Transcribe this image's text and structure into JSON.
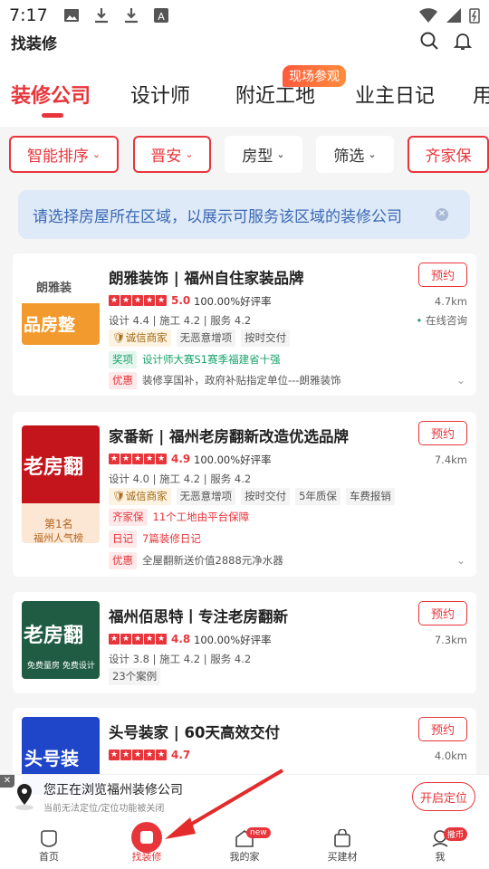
{
  "status": {
    "time": "7:17"
  },
  "appbar": {
    "title": "找装修"
  },
  "tabs": [
    {
      "label": "装修公司"
    },
    {
      "label": "设计师"
    },
    {
      "label": "附近工地",
      "badge": "现场参观"
    },
    {
      "label": "业主日记"
    },
    {
      "label": "用"
    }
  ],
  "filters": [
    {
      "label": "智能排序"
    },
    {
      "label": "晋安"
    },
    {
      "label": "房型"
    },
    {
      "label": "筛选"
    },
    {
      "label": "齐家保"
    }
  ],
  "notice": {
    "text": "请选择房屋所在区域，以展示可服务该区域的装修公司"
  },
  "companies": [
    {
      "name": "朗雅装饰 | 福州自住家装品牌",
      "logo_text": "品房整",
      "logo_brand": "朗雅装",
      "score": "5.0",
      "rating": "100.00%好评率",
      "distance": "4.7km",
      "scores": "设计 4.4 | 施工 4.2 | 服务 4.2",
      "online": "在线咨询",
      "tags": [
        "诚信商家",
        "无恶意增项",
        "按时交付"
      ],
      "award_tag": "奖项",
      "award_text": "设计师大赛S1赛季福建省十强",
      "promo_tag": "优惠",
      "promo_text": "装修享国补，政府补贴指定单位---朗雅装饰",
      "book": "预约"
    },
    {
      "name": "家番新 | 福州老房翻新改造优选品牌",
      "logo_text": "老房翻",
      "rank_label": "第1名",
      "rank_sub": "福州人气榜",
      "score": "4.9",
      "rating": "100.00%好评率",
      "distance": "7.4km",
      "scores": "设计 4.0 | 施工 4.2 | 服务 4.2",
      "tags": [
        "诚信商家",
        "无恶意增项",
        "按时交付",
        "5年质保",
        "车费报销"
      ],
      "guarantee_tag": "齐家保",
      "guarantee_text": "11个工地由平台保障",
      "diary_tag": "日记",
      "diary_text": "7篇装修日记",
      "promo_tag": "优惠",
      "promo_text": "全屋翻新送价值2888元净水器",
      "book": "预约"
    },
    {
      "name": "福州佰思特丨专注老房翻新",
      "logo_text": "老房翻",
      "logo_sub": "免费量房  免费设计",
      "score": "4.8",
      "rating": "100.00%好评率",
      "distance": "7.3km",
      "scores": "设计 3.8 | 施工 4.2 | 服务 4.2",
      "cases": "23个案例",
      "book": "预约"
    },
    {
      "name": "头号装家 | 60天高效交付",
      "logo_text": "头号装",
      "score": "4.7",
      "distance": "4.0km",
      "book": "预约"
    }
  ],
  "location_bar": {
    "title": "您正在浏览福州装修公司",
    "subtitle": "当前无法定位/定位功能被关闭",
    "button": "开启定位"
  },
  "bottom_nav": [
    {
      "label": "首页"
    },
    {
      "label": "找装修"
    },
    {
      "label": "我的家",
      "badge": "new"
    },
    {
      "label": "买建材"
    },
    {
      "label": "我",
      "badge": "撒币"
    }
  ],
  "colors": {
    "accent": "#e8353b",
    "notice_bg": "#dfeaf8",
    "notice_text": "#3a68b3"
  }
}
